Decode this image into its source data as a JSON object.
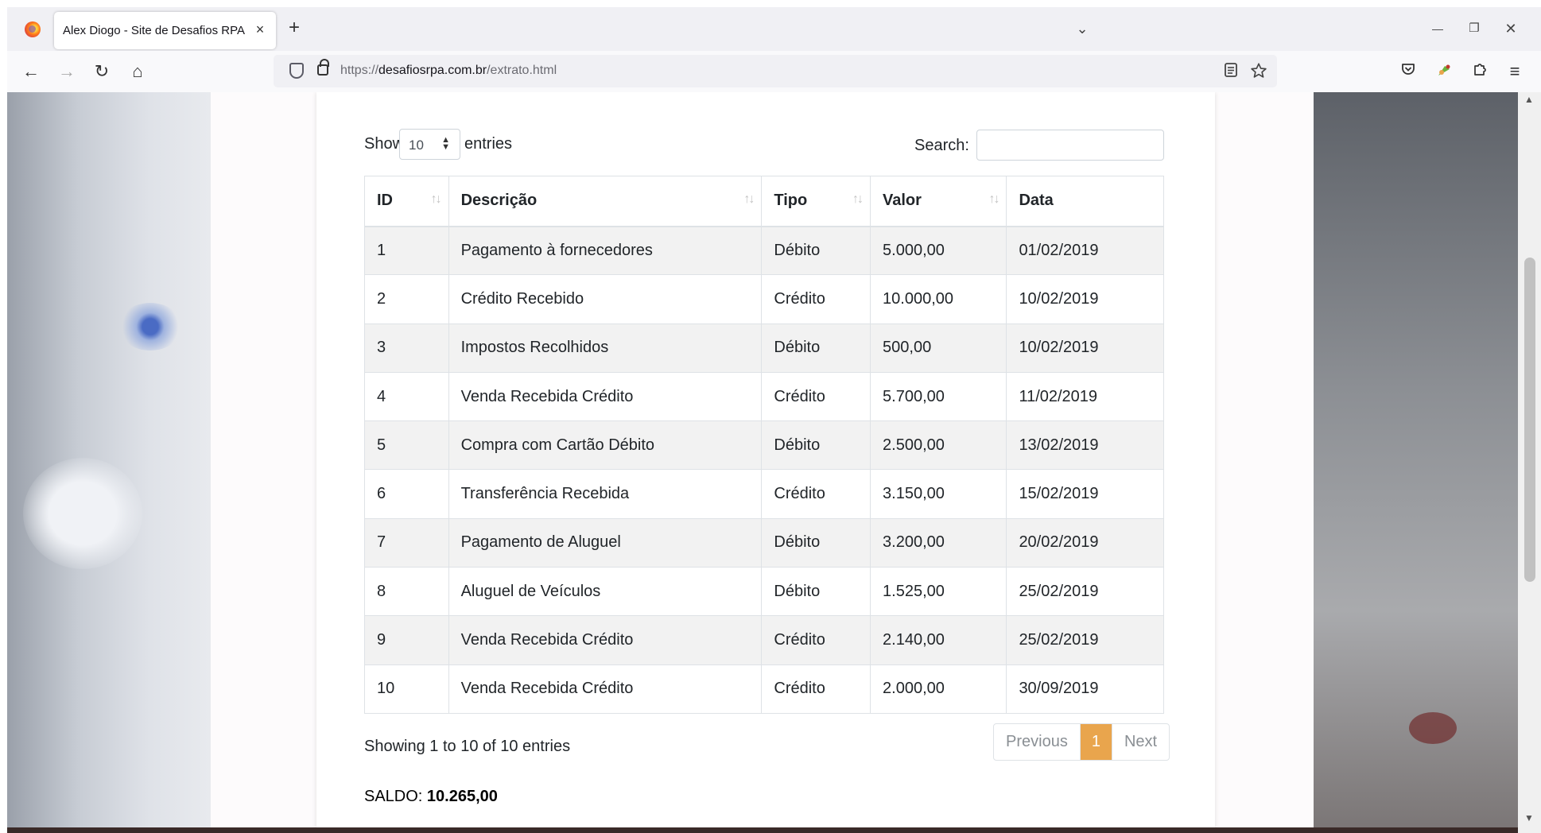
{
  "browser": {
    "tab_title": "Alex Diogo - Site de Desafios RPA",
    "tab_close": "×",
    "new_tab": "+",
    "tab_list": "⌄",
    "minimize": "—",
    "restore": "❐",
    "close": "✕",
    "url_scheme": "https://",
    "url_host": "desafiosrpa.com.br",
    "url_path": "/extrato.html"
  },
  "nav": {
    "back": "←",
    "forward": "→",
    "reload": "↻",
    "home": "⌂",
    "menu": "≡"
  },
  "table_controls": {
    "show_label": "Show",
    "length_value": "10",
    "entries_label": "entries",
    "search_label": "Search:",
    "search_value": ""
  },
  "table": {
    "headers": [
      "ID",
      "Descrição",
      "Tipo",
      "Valor",
      "Data"
    ],
    "rows": [
      [
        "1",
        "Pagamento à fornecedores",
        "Débito",
        "5.000,00",
        "01/02/2019"
      ],
      [
        "2",
        "Crédito Recebido",
        "Crédito",
        "10.000,00",
        "10/02/2019"
      ],
      [
        "3",
        "Impostos Recolhidos",
        "Débito",
        "500,00",
        "10/02/2019"
      ],
      [
        "4",
        "Venda Recebida Crédito",
        "Crédito",
        "5.700,00",
        "11/02/2019"
      ],
      [
        "5",
        "Compra com Cartão Débito",
        "Débito",
        "2.500,00",
        "13/02/2019"
      ],
      [
        "6",
        "Transferência Recebida",
        "Crédito",
        "3.150,00",
        "15/02/2019"
      ],
      [
        "7",
        "Pagamento de Aluguel",
        "Débito",
        "3.200,00",
        "20/02/2019"
      ],
      [
        "8",
        "Aluguel de Veículos",
        "Débito",
        "1.525,00",
        "25/02/2019"
      ],
      [
        "9",
        "Venda Recebida Crédito",
        "Crédito",
        "2.140,00",
        "25/02/2019"
      ],
      [
        "10",
        "Venda Recebida Crédito",
        "Crédito",
        "2.000,00",
        "30/09/2019"
      ]
    ]
  },
  "footer": {
    "info": "Showing 1 to 10 of 10 entries",
    "previous": "Previous",
    "current_page": "1",
    "next": "Next",
    "saldo_label": "SALDO:",
    "saldo_value": "10.265,00"
  },
  "colors": {
    "pagination_active": "#e9a54d",
    "striped_row": "#f2f2f2"
  }
}
